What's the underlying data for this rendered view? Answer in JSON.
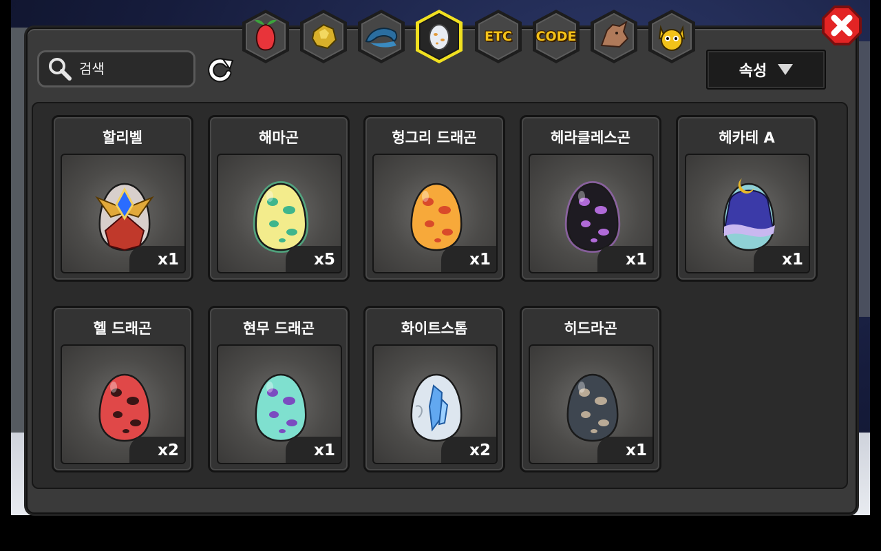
{
  "search": {
    "placeholder": "검색"
  },
  "sort": {
    "label": "속성"
  },
  "tabs": [
    {
      "name": "fruit",
      "icon": "fruit-icon",
      "text": ""
    },
    {
      "name": "gold",
      "icon": "gold-ore-icon",
      "text": ""
    },
    {
      "name": "dragon-scale",
      "icon": "dragon-head-icon",
      "text": ""
    },
    {
      "name": "egg",
      "icon": "egg-icon",
      "text": "",
      "active": true
    },
    {
      "name": "etc",
      "icon": "",
      "text": "ETC"
    },
    {
      "name": "code",
      "icon": "",
      "text": "CODE"
    },
    {
      "name": "statue",
      "icon": "dragon-statue-icon",
      "text": ""
    },
    {
      "name": "mascot",
      "icon": "mascot-face-icon",
      "text": ""
    }
  ],
  "items": [
    {
      "name": "할리벨",
      "qty": "x1",
      "egg": "crest",
      "base": "#d8cfcc",
      "spot": "#c0392b",
      "accent": "#2a6cff"
    },
    {
      "name": "해마곤",
      "qty": "x5",
      "egg": "spotted",
      "base": "#f3ec8c",
      "spot": "#3fb58c",
      "glow": "#4fe2a0"
    },
    {
      "name": "헝그리 드래곤",
      "qty": "x1",
      "egg": "spotted",
      "base": "#f7a93a",
      "spot": "#d94a2a"
    },
    {
      "name": "헤라클레스곤",
      "qty": "x1",
      "egg": "spotted",
      "base": "#1e1b22",
      "spot": "#b06ad8",
      "glow": "#b06ad8"
    },
    {
      "name": "헤카테 A",
      "qty": "x1",
      "egg": "hooded",
      "base": "#8fd1d6",
      "spot": "#3b3aa8",
      "accent": "#e8b92a"
    },
    {
      "name": "헬 드래곤",
      "qty": "x2",
      "egg": "spotted",
      "base": "#e04848",
      "spot": "#3a1515"
    },
    {
      "name": "현무 드래곤",
      "qty": "x1",
      "egg": "spotted",
      "base": "#7fe0cf",
      "spot": "#7b4cc0"
    },
    {
      "name": "화이트스톰",
      "qty": "x2",
      "egg": "crystal",
      "base": "#dde6ef",
      "spot": "#62a8f0"
    },
    {
      "name": "히드라곤",
      "qty": "x1",
      "egg": "spotted",
      "base": "#3e4650",
      "spot": "#b9aa96"
    }
  ]
}
